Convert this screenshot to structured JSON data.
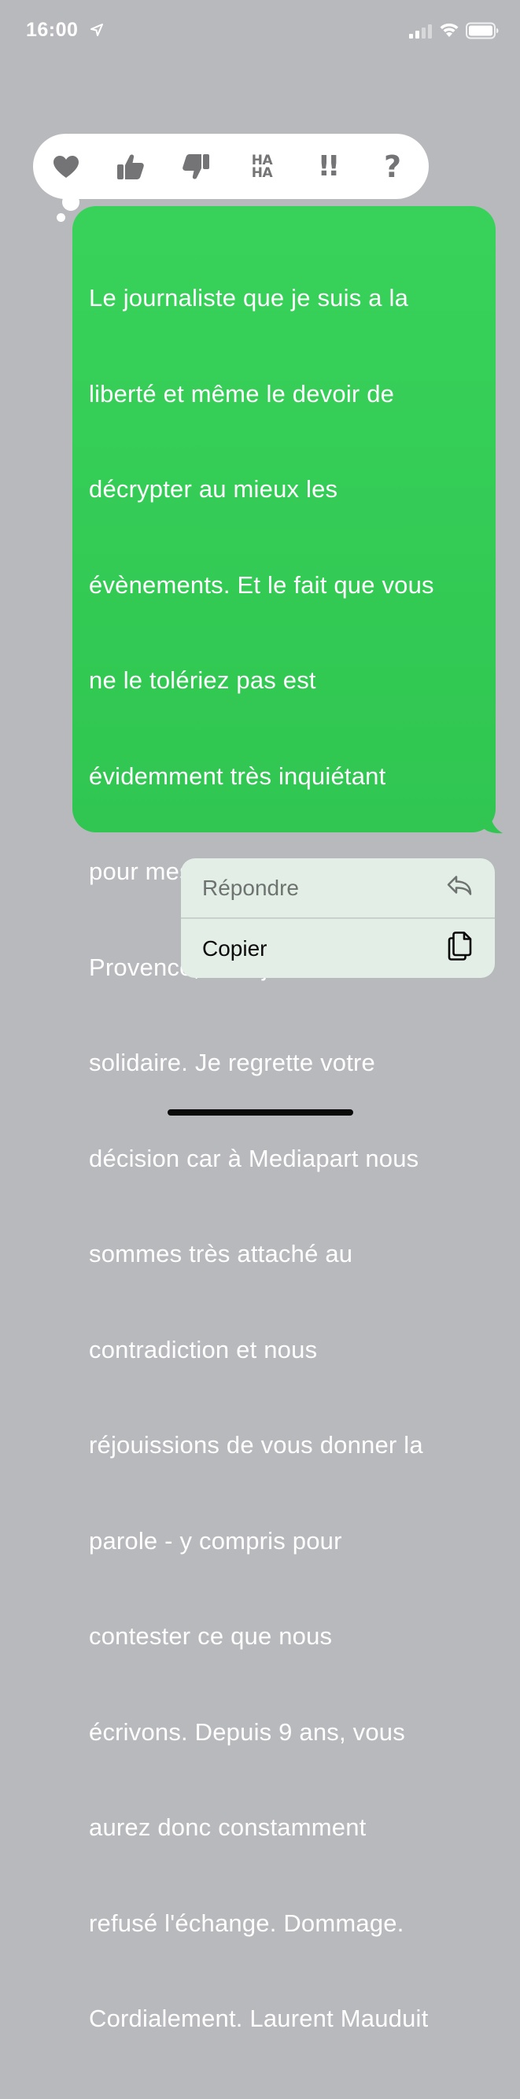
{
  "status_bar": {
    "time": "16:00",
    "icons": [
      "location-arrow-icon",
      "cellular-signal-icon",
      "wifi-icon",
      "battery-icon"
    ]
  },
  "tapback": {
    "reactions": [
      {
        "name": "heart-icon"
      },
      {
        "name": "thumbs-up-icon"
      },
      {
        "name": "thumbs-down-icon"
      },
      {
        "name": "haha-icon",
        "line1": "HA",
        "line2": "HA"
      },
      {
        "name": "exclamation-icon",
        "glyph": "!!"
      },
      {
        "name": "question-icon",
        "glyph": "?"
      }
    ]
  },
  "message": {
    "lines": [
      "Le journaliste que je suis a la",
      "liberté et même le devoir de",
      "décrypter au mieux les",
      "évènements. Et le fait que vous",
      "ne le tolériez pas est",
      "évidemment très inquiétant",
      "pour mes confrères de La",
      "Provence, dont je suis",
      "solidaire. Je regrette votre",
      "décision car à Mediapart nous",
      "sommes très attaché au",
      "contradiction et nous",
      "réjouissions de vous donner la",
      "parole - y compris pour",
      "contester ce que nous",
      "écrivons. Depuis 9 ans, vous",
      "aurez donc constamment",
      "refusé l'échange. Dommage.",
      "Cordialement. Laurent Mauduit"
    ],
    "bubble_color": "#34c759"
  },
  "context_menu": {
    "reply_label": "Répondre",
    "copy_label": "Copier",
    "reply_icon": "reply-arrow-icon",
    "copy_icon": "copy-documents-icon"
  },
  "colors": {
    "background": "#b8b9bd",
    "reaction_gray": "#747476",
    "menu_background": "#e3eee7"
  }
}
